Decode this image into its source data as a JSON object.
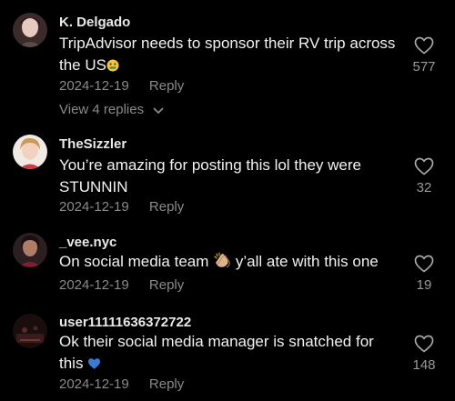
{
  "comments": [
    {
      "username": "K. Delgado",
      "text": "TripAdvisor needs to sponsor their RV trip across the US",
      "emoji": "money-mouth-face",
      "date": "2024-12-19",
      "reply_label": "Reply",
      "view_replies_label": "View 4 replies",
      "likes": "577"
    },
    {
      "username": "TheSizzler",
      "text": "You’re amazing for posting this lol they were STUNNIN",
      "date": "2024-12-19",
      "reply_label": "Reply",
      "likes": "32"
    },
    {
      "username": "_vee.nyc",
      "text_before": "On social media team",
      "emoji": "clapping-hands",
      "text_after": "y’all ate with this one",
      "date": "2024-12-19",
      "reply_label": "Reply",
      "likes": "19"
    },
    {
      "username": "user11111636372722",
      "text": "Ok their social media manager is snatched for this",
      "emoji": "blue-heart",
      "date": "2024-12-19",
      "reply_label": "Reply",
      "likes": "148"
    }
  ],
  "colors": {
    "background": "#000000",
    "secondary_text": "#8a8a8a",
    "blue_heart": "#3a7bd5"
  }
}
